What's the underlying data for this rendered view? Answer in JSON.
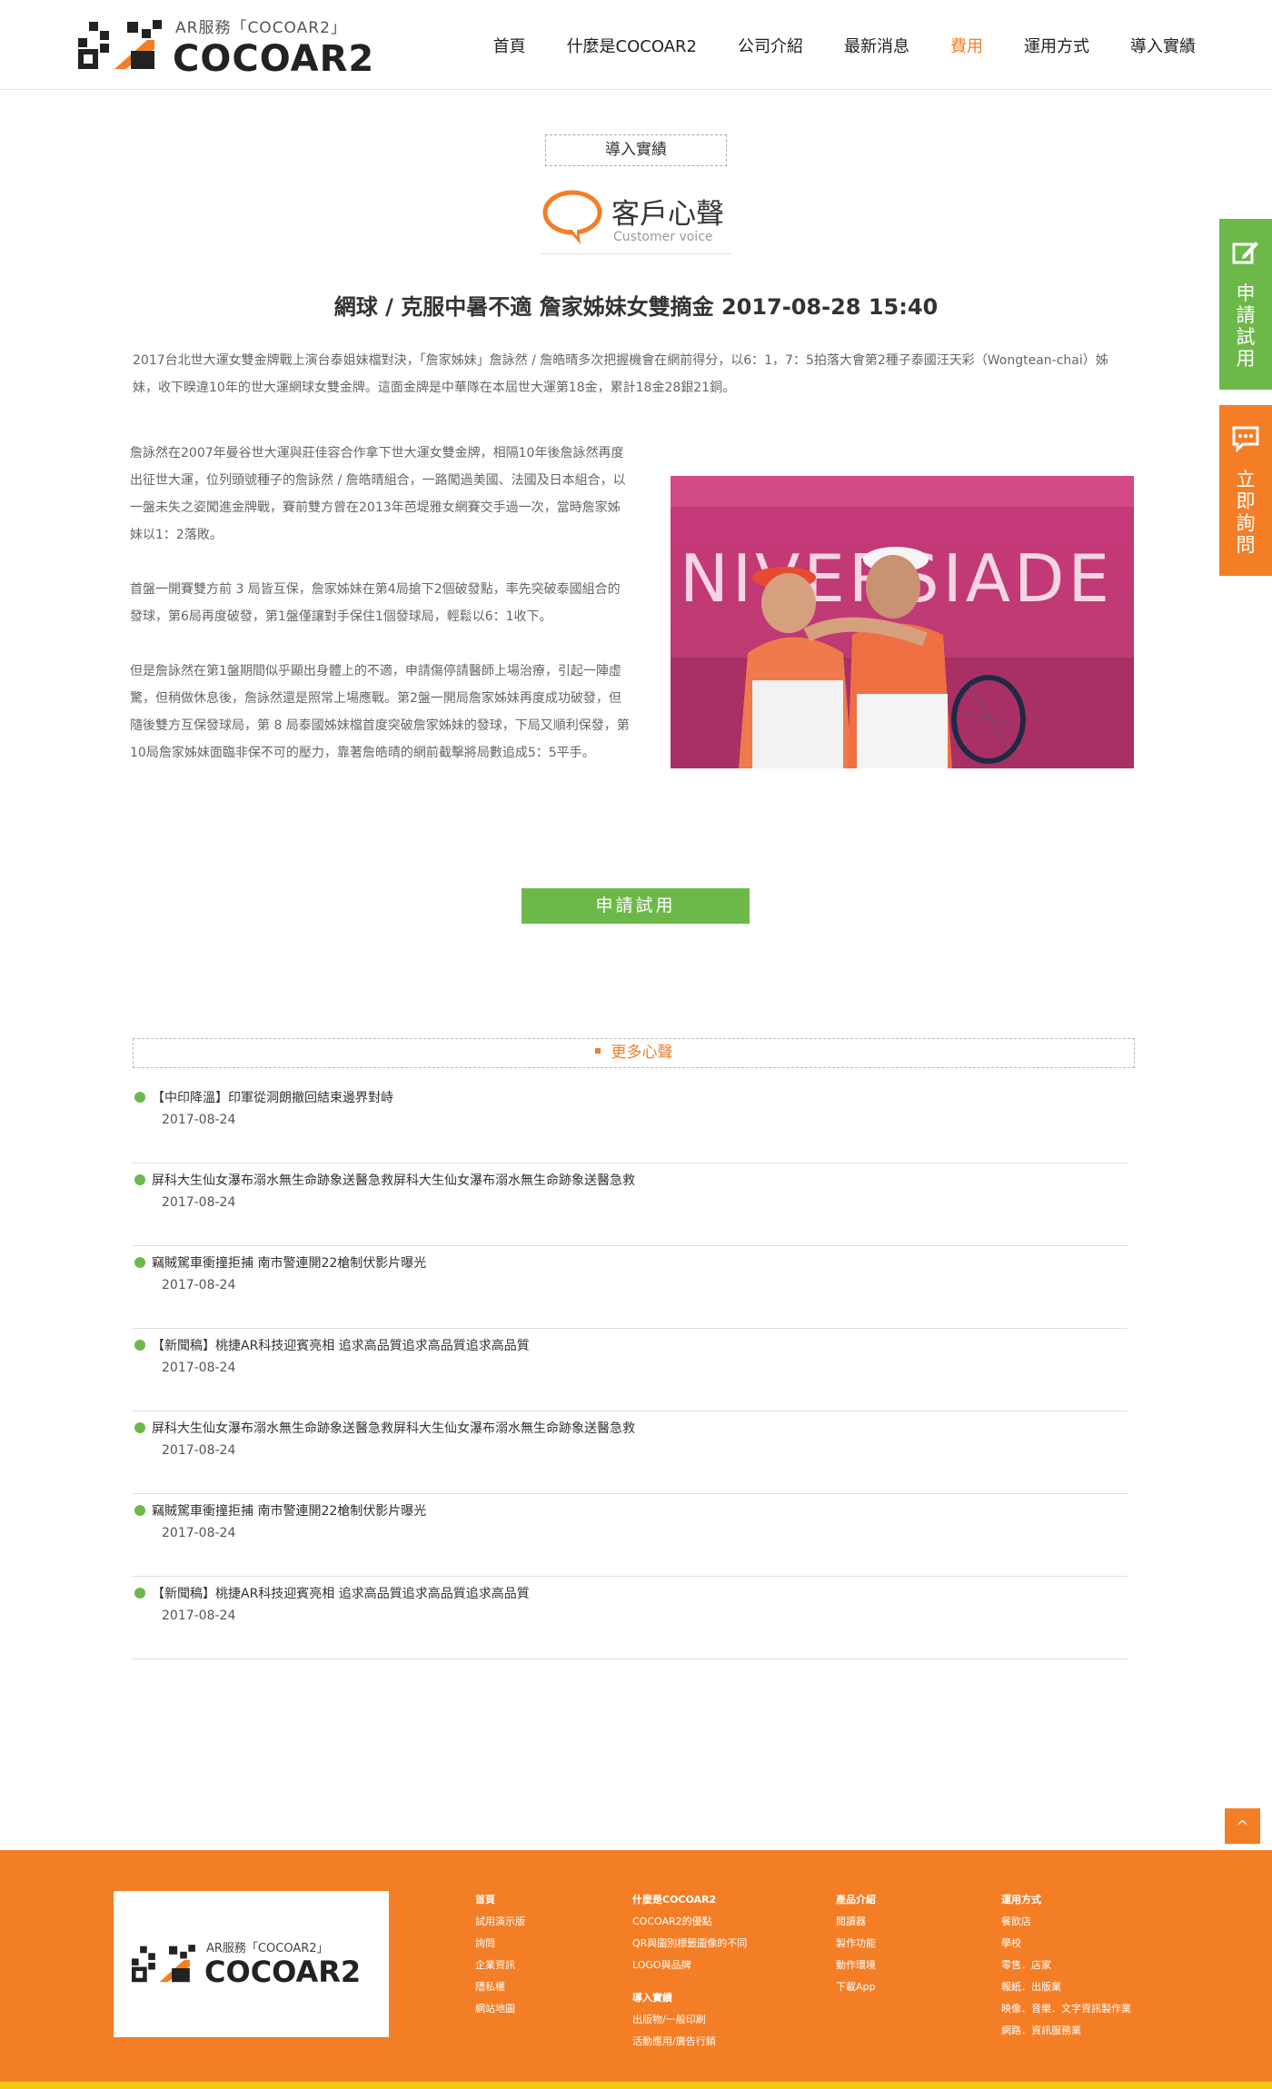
{
  "header": {
    "tagline": "AR服務「COCOAR2」",
    "brand": "COCOAR2",
    "nav": [
      "首頁",
      "什麼是COCOAR2",
      "公司介紹",
      "最新消息",
      "費用",
      "運用方式",
      "導入實績"
    ],
    "active_nav": "費用"
  },
  "section_tag": "導入實績",
  "voice_title": {
    "zh": "客戶心聲",
    "en": "Customer voice"
  },
  "article": {
    "title": "網球 / 克服中暑不適 詹家姊妹女雙摘金  2017-08-28 15:40",
    "intro": "2017台北世大運女雙金牌戰上演台泰姐妹檔對決，「詹家姊妹」詹詠然 / 詹皓晴多次把握機會在網前得分，以6：1，7：5拍落大會第2種子泰國汪天彩（Wongtean-chai）姊妹，收下睽違10年的世大運網球女雙金牌。這面金牌是中華隊在本屆世大運第18金，累計18金28銀21銅。",
    "paragraphs": [
      "詹詠然在2007年曼谷世大運與莊佳容合作拿下世大運女雙金牌，相隔10年後詹詠然再度出征世大運，位列頭號種子的詹詠然 / 詹皓晴組合，一路闖過美國、法國及日本組合，以一盤未失之姿闖進金牌戰，賽前雙方曾在2013年芭堤雅女網賽交手過一次，當時詹家姊妹以1：2落敗。",
      "首盤一開賽雙方前 3 局皆互保，詹家姊妹在第4局搶下2個破發點，率先突破泰國組合的發球，第6局再度破發，第1盤僅讓對手保住1個發球局，輕鬆以6：1收下。",
      "但是詹詠然在第1盤期間似乎顯出身體上的不適，申請傷停請醫師上場治療，引起一陣虛驚，但稍做休息後，詹詠然還是照常上場應戰。第2盤一開局詹家姊妹再度成功破發，但隨後雙方互保發球局，第 8 局泰國姊妹檔首度突破詹家姊妹的發球，下局又順利保發，第10局詹家姊妹面臨非保不可的壓力，靠著詹皓晴的網前截擊將局數追成5：5平手。"
    ],
    "photo_banner_text": "NIVERSIADE"
  },
  "trial_button": "申請試用",
  "more_voices": {
    "header": "更多心聲",
    "items": [
      {
        "title": "【中印降溫】印軍從洞朗撤回結束邊界對峙",
        "date": "2017-08-24"
      },
      {
        "title": "屏科大生仙女瀑布溺水無生命跡象送醫急救屏科大生仙女瀑布溺水無生命跡象送醫急救",
        "date": "2017-08-24"
      },
      {
        "title": "竊賊駕車衝撞拒捕 南市警連開22槍制伏影片曝光",
        "date": "2017-08-24"
      },
      {
        "title": "【新聞稿】桃捷AR科技迎賓亮相 追求高品質追求高品質追求高品質",
        "date": "2017-08-24"
      },
      {
        "title": "屏科大生仙女瀑布溺水無生命跡象送醫急救屏科大生仙女瀑布溺水無生命跡象送醫急救",
        "date": "2017-08-24"
      },
      {
        "title": "竊賊駕車衝撞拒捕 南市警連開22槍制伏影片曝光",
        "date": "2017-08-24"
      },
      {
        "title": "【新聞稿】桃捷AR科技迎賓亮相 追求高品質追求高品質追求高品質",
        "date": "2017-08-24"
      }
    ]
  },
  "side": {
    "trial": "申請試用",
    "inquire": "立即詢問"
  },
  "back_to_top": "^",
  "footer": {
    "tagline": "AR服務「COCOAR2」",
    "brand": "COCOAR2",
    "col1": [
      "首頁",
      "試用演示版",
      "詢問",
      "企業資訊",
      "隱私權",
      "網站地圖"
    ],
    "col2a": [
      "什麼是COCOAR2",
      "COCOAR2的優點",
      "QR與圖別標籤圖像的不同",
      "LOGO與品牌"
    ],
    "col2b": [
      "導入實績",
      "出版物/一般印刷",
      "活動應用/廣告行銷"
    ],
    "col3": [
      "產品介紹",
      "閱讀器",
      "製作功能",
      "動作環境",
      "下載App"
    ],
    "col4": [
      "運用方式",
      "餐飲店",
      "學校",
      "零售．店家",
      "報紙．出版業",
      "映像．音樂．文字資訊製作業",
      "網路．資訊服務業"
    ]
  },
  "colors": {
    "accent": "#f47e26",
    "green": "#6cb949",
    "yellow": "#f7c517"
  }
}
